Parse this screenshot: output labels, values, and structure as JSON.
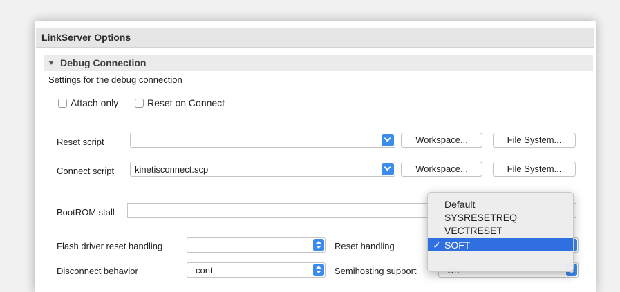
{
  "window": {
    "title": "LinkServer Options"
  },
  "section": {
    "title": "Debug Connection",
    "description": "Settings for the debug connection"
  },
  "checkboxes": {
    "attach_only": "Attach only",
    "reset_on_connect": "Reset on Connect"
  },
  "reset_script": {
    "label": "Reset script",
    "value": "",
    "workspace_button": "Workspace...",
    "filesystem_button": "File System..."
  },
  "connect_script": {
    "label": "Connect script",
    "value": "kinetisconnect.scp",
    "workspace_button": "Workspace...",
    "filesystem_button": "File System..."
  },
  "bootrom": {
    "label": "BootROM stall",
    "value": ""
  },
  "flash_driver": {
    "label": "Flash driver reset handling",
    "value": ""
  },
  "reset_handling": {
    "label": "Reset handling",
    "options": [
      "Default",
      "SYSRESETREQ",
      "VECTRESET",
      "SOFT"
    ],
    "selected": "SOFT",
    "check_glyph": "✓"
  },
  "disconnect": {
    "label": "Disconnect behavior",
    "value": "cont"
  },
  "semihosting": {
    "label": "Semihosting support",
    "value": "On"
  },
  "colors": {
    "accent": "#3b8ced",
    "menu_selection": "#2f6fe0"
  }
}
